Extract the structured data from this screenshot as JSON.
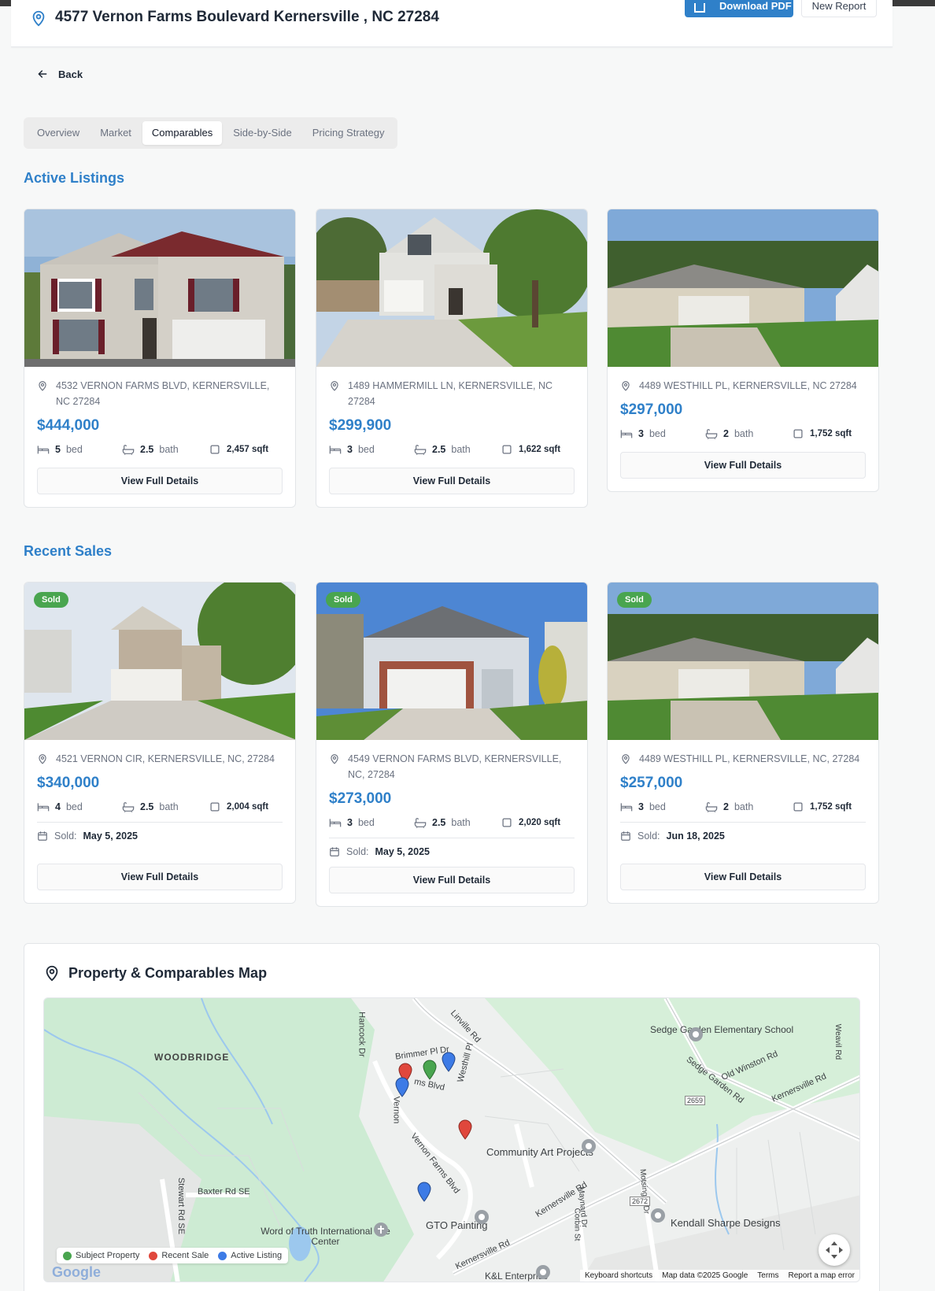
{
  "header": {
    "address": "4577 Vernon Farms Boulevard Kernersville , NC 27284",
    "download_label": "Download PDF",
    "new_report_label": "New Report"
  },
  "back_label": "Back",
  "tabs": [
    "Overview",
    "Market",
    "Comparables",
    "Side-by-Side",
    "Pricing Strategy"
  ],
  "active_tab": "Comparables",
  "active_listings": {
    "title": "Active Listings",
    "items": [
      {
        "address": "4532 VERNON FARMS BLVD, KERNERSVILLE, NC 27284",
        "price": "$444,000",
        "bed": "5",
        "bath": "2.5",
        "sqft": "2,457 sqft",
        "button": "View Full Details"
      },
      {
        "address": "1489 HAMMERMILL LN, KERNERSVILLE, NC 27284",
        "price": "$299,900",
        "bed": "3",
        "bath": "2.5",
        "sqft": "1,622 sqft",
        "button": "View Full Details"
      },
      {
        "address": "4489 WESTHILL PL, KERNERSVILLE, NC 27284",
        "price": "$297,000",
        "bed": "3",
        "bath": "2",
        "sqft": "1,752 sqft",
        "button": "View Full Details"
      }
    ]
  },
  "recent_sales": {
    "title": "Recent Sales",
    "badge": "Sold",
    "sold_label": "Sold:",
    "items": [
      {
        "address": "4521 VERNON CIR, KERNERSVILLE, NC, 27284",
        "price": "$340,000",
        "bed": "4",
        "bath": "2.5",
        "sqft": "2,004 sqft",
        "sold_date": "May 5, 2025",
        "button": "View Full Details"
      },
      {
        "address": "4549 VERNON FARMS BLVD, KERNERSVILLE, NC, 27284",
        "price": "$273,000",
        "bed": "3",
        "bath": "2.5",
        "sqft": "2,020 sqft",
        "sold_date": "May 5, 2025",
        "button": "View Full Details"
      },
      {
        "address": "4489 WESTHILL PL, KERNERSVILLE, NC, 27284",
        "price": "$257,000",
        "bed": "3",
        "bath": "2",
        "sqft": "1,752 sqft",
        "sold_date": "Jun 18, 2025",
        "button": "View Full Details"
      }
    ]
  },
  "units": {
    "bed": "bed",
    "bath": "bath"
  },
  "map": {
    "title": "Property & Comparables Map",
    "labels": {
      "woodbridge": "WOODBRIDGE",
      "sedge_school": "Sedge Garden Elementary School",
      "hancock": "Hancock Dr",
      "linville": "Linville Rd",
      "brimmer": "Brimmer Pl Dr",
      "westhill": "Westhill Pl",
      "farms_blvd": "ms Blvd",
      "vernon": "Vernon",
      "vernon_farms": "Vernon Farms Blvd",
      "community_art": "Community Art Projects",
      "stewart": "Stewart Rd SE",
      "baxter": "Baxter Rd SE",
      "gto": "GTO Painting",
      "word_of_truth": "Word of Truth International Life Center",
      "kernersville_rd": "Kernersville Rd",
      "corbin": "Corbin St",
      "maynard": "Maynard Dr",
      "motsinger": "Motsinger Dr",
      "kendall": "Kendall Sharpe Designs",
      "old_winston": "Old Winston Rd",
      "sedge_garden_rd": "Sedge Garden Rd",
      "weavil": "Weavil Rd",
      "route_2659": "2659",
      "route_2672": "2672",
      "kl_enterprise": "K&L Enterprise"
    },
    "legend": [
      {
        "label": "Subject Property",
        "color": "#49a54f"
      },
      {
        "label": "Recent Sale",
        "color": "#e0473c"
      },
      {
        "label": "Active Listing",
        "color": "#3d7be6"
      }
    ],
    "footer": [
      "Keyboard shortcuts",
      "Map data ©2025 Google",
      "Terms",
      "Report a map error"
    ]
  },
  "colors": {
    "accent": "#2f80c9",
    "sold_badge": "#49a54f"
  }
}
